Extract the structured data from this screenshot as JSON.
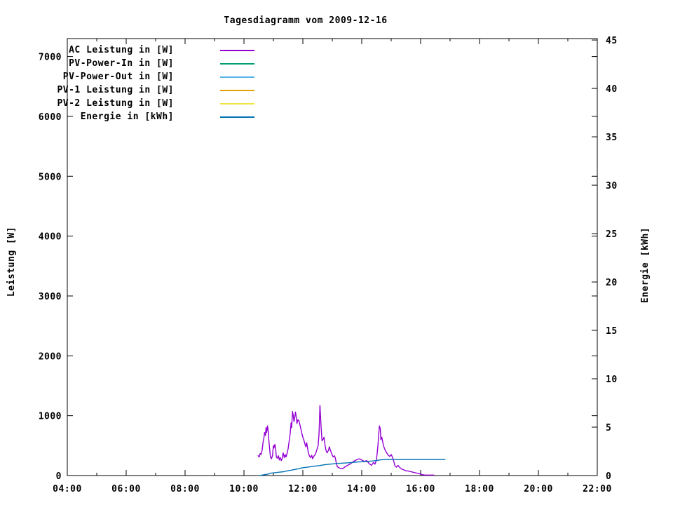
{
  "chart_data": {
    "type": "line",
    "title": "Tagesdiagramm vom 2009-12-16",
    "colors": {
      "background": "#ffffff",
      "foreground": "#000000"
    },
    "x_axis": {
      "range_hours": [
        4,
        22
      ],
      "major_tick_every_hours": 2,
      "minor_tick_every_hours": 1,
      "tick_labels": [
        "04:00",
        "06:00",
        "08:00",
        "10:00",
        "12:00",
        "14:00",
        "16:00",
        "18:00",
        "20:00",
        "22:00"
      ]
    },
    "y_left": {
      "label": "Leistung [W]",
      "range": [
        0,
        7300
      ],
      "ticks": [
        0,
        1000,
        2000,
        3000,
        4000,
        5000,
        6000,
        7000
      ]
    },
    "y_right": {
      "label": "Energie [kWh]",
      "range": [
        0,
        45.15
      ],
      "ticks": [
        0,
        5,
        10,
        15,
        20,
        25,
        30,
        35,
        40,
        45
      ]
    },
    "legend": [
      {
        "label": "AC Leistung in [W]",
        "color": "#9400d3"
      },
      {
        "label": "PV-Power-In in [W]",
        "color": "#009e73"
      },
      {
        "label": "PV-Power-Out in [W]",
        "color": "#56b4e9"
      },
      {
        "label": "PV-1 Leistung in [W]",
        "color": "#e69f00"
      },
      {
        "label": "PV-2 Leistung in [W]",
        "color": "#f0e442"
      },
      {
        "label": "Energie in [kWh]",
        "color": "#0072b2"
      }
    ],
    "legend_position": "top-left-inside",
    "grid": false,
    "series": [
      {
        "key": "ac-leistung",
        "name": "AC Leistung in [W]",
        "color": "#9400d3",
        "axis": "left",
        "points": [
          [
            10.48,
            330
          ],
          [
            10.52,
            310
          ],
          [
            10.55,
            370
          ],
          [
            10.58,
            350
          ],
          [
            10.62,
            430
          ],
          [
            10.65,
            560
          ],
          [
            10.68,
            640
          ],
          [
            10.7,
            720
          ],
          [
            10.73,
            670
          ],
          [
            10.75,
            800
          ],
          [
            10.77,
            720
          ],
          [
            10.8,
            830
          ],
          [
            10.82,
            760
          ],
          [
            10.85,
            560
          ],
          [
            10.88,
            400
          ],
          [
            10.9,
            310
          ],
          [
            10.93,
            280
          ],
          [
            10.97,
            330
          ],
          [
            11.0,
            500
          ],
          [
            11.02,
            460
          ],
          [
            11.05,
            520
          ],
          [
            11.08,
            420
          ],
          [
            11.1,
            310
          ],
          [
            11.13,
            290
          ],
          [
            11.17,
            330
          ],
          [
            11.2,
            260
          ],
          [
            11.23,
            300
          ],
          [
            11.27,
            250
          ],
          [
            11.3,
            290
          ],
          [
            11.33,
            380
          ],
          [
            11.37,
            300
          ],
          [
            11.4,
            350
          ],
          [
            11.43,
            310
          ],
          [
            11.47,
            380
          ],
          [
            11.5,
            450
          ],
          [
            11.53,
            560
          ],
          [
            11.57,
            700
          ],
          [
            11.6,
            880
          ],
          [
            11.62,
            800
          ],
          [
            11.65,
            1070
          ],
          [
            11.68,
            980
          ],
          [
            11.7,
            900
          ],
          [
            11.73,
            1000
          ],
          [
            11.75,
            1060
          ],
          [
            11.78,
            950
          ],
          [
            11.8,
            870
          ],
          [
            11.83,
            930
          ],
          [
            11.87,
            915
          ],
          [
            11.9,
            850
          ],
          [
            11.93,
            780
          ],
          [
            11.97,
            700
          ],
          [
            12.0,
            640
          ],
          [
            12.03,
            600
          ],
          [
            12.07,
            530
          ],
          [
            12.1,
            480
          ],
          [
            12.13,
            550
          ],
          [
            12.17,
            430
          ],
          [
            12.2,
            360
          ],
          [
            12.23,
            320
          ],
          [
            12.27,
            300
          ],
          [
            12.3,
            340
          ],
          [
            12.33,
            280
          ],
          [
            12.37,
            320
          ],
          [
            12.42,
            350
          ],
          [
            12.47,
            420
          ],
          [
            12.52,
            500
          ],
          [
            12.55,
            700
          ],
          [
            12.58,
            1170
          ],
          [
            12.6,
            1000
          ],
          [
            12.62,
            820
          ],
          [
            12.65,
            580
          ],
          [
            12.68,
            600
          ],
          [
            12.72,
            640
          ],
          [
            12.75,
            520
          ],
          [
            12.78,
            430
          ],
          [
            12.82,
            380
          ],
          [
            12.87,
            420
          ],
          [
            12.9,
            480
          ],
          [
            12.93,
            430
          ],
          [
            12.97,
            380
          ],
          [
            13.0,
            340
          ],
          [
            13.03,
            310
          ],
          [
            13.07,
            330
          ],
          [
            13.1,
            300
          ],
          [
            13.13,
            220
          ],
          [
            13.17,
            150
          ],
          [
            13.22,
            130
          ],
          [
            13.28,
            120
          ],
          [
            13.35,
            115
          ],
          [
            13.42,
            140
          ],
          [
            13.5,
            165
          ],
          [
            13.58,
            185
          ],
          [
            13.67,
            215
          ],
          [
            13.75,
            245
          ],
          [
            13.83,
            265
          ],
          [
            13.92,
            280
          ],
          [
            14.0,
            260
          ],
          [
            14.08,
            235
          ],
          [
            14.17,
            250
          ],
          [
            14.25,
            200
          ],
          [
            14.33,
            170
          ],
          [
            14.4,
            220
          ],
          [
            14.45,
            190
          ],
          [
            14.5,
            260
          ],
          [
            14.55,
            500
          ],
          [
            14.6,
            830
          ],
          [
            14.63,
            780
          ],
          [
            14.65,
            600
          ],
          [
            14.68,
            640
          ],
          [
            14.72,
            550
          ],
          [
            14.75,
            480
          ],
          [
            14.8,
            420
          ],
          [
            14.85,
            380
          ],
          [
            14.9,
            340
          ],
          [
            14.95,
            320
          ],
          [
            15.0,
            350
          ],
          [
            15.05,
            300
          ],
          [
            15.08,
            250
          ],
          [
            15.13,
            160
          ],
          [
            15.18,
            140
          ],
          [
            15.23,
            170
          ],
          [
            15.28,
            140
          ],
          [
            15.35,
            110
          ],
          [
            15.43,
            95
          ],
          [
            15.5,
            80
          ],
          [
            15.58,
            75
          ],
          [
            15.67,
            65
          ],
          [
            15.75,
            55
          ],
          [
            15.83,
            45
          ],
          [
            15.92,
            35
          ],
          [
            16.0,
            25
          ],
          [
            16.08,
            12
          ],
          [
            16.15,
            8
          ],
          [
            16.45,
            8
          ]
        ]
      },
      {
        "key": "pv-power-in",
        "name": "PV-Power-In in [W]",
        "color": "#009e73",
        "axis": "left",
        "points": []
      },
      {
        "key": "pv-power-out",
        "name": "PV-Power-Out in [W]",
        "color": "#56b4e9",
        "axis": "left",
        "points": []
      },
      {
        "key": "pv1-leistung",
        "name": "PV-1 Leistung in [W]",
        "color": "#e69f00",
        "axis": "left",
        "points": []
      },
      {
        "key": "pv2-leistung",
        "name": "PV-2 Leistung in [W]",
        "color": "#f0e442",
        "axis": "left",
        "points": []
      },
      {
        "key": "energie",
        "name": "Energie in [kWh]",
        "color": "#0072b2",
        "axis": "right",
        "points": [
          [
            10.52,
            0.0
          ],
          [
            10.62,
            0.05
          ],
          [
            10.72,
            0.1
          ],
          [
            10.82,
            0.15
          ],
          [
            10.92,
            0.25
          ],
          [
            11.05,
            0.3
          ],
          [
            11.2,
            0.35
          ],
          [
            11.35,
            0.4
          ],
          [
            11.5,
            0.5
          ],
          [
            11.6,
            0.55
          ],
          [
            11.72,
            0.62
          ],
          [
            11.85,
            0.7
          ],
          [
            11.95,
            0.78
          ],
          [
            12.1,
            0.85
          ],
          [
            12.25,
            0.9
          ],
          [
            12.4,
            0.97
          ],
          [
            12.55,
            1.02
          ],
          [
            12.7,
            1.1
          ],
          [
            12.85,
            1.15
          ],
          [
            13.0,
            1.2
          ],
          [
            13.15,
            1.25
          ],
          [
            13.35,
            1.28
          ],
          [
            13.55,
            1.32
          ],
          [
            13.75,
            1.38
          ],
          [
            13.95,
            1.42
          ],
          [
            14.15,
            1.45
          ],
          [
            14.35,
            1.5
          ],
          [
            14.5,
            1.55
          ],
          [
            14.65,
            1.62
          ],
          [
            14.8,
            1.65
          ],
          [
            16.83,
            1.65
          ]
        ]
      }
    ]
  }
}
